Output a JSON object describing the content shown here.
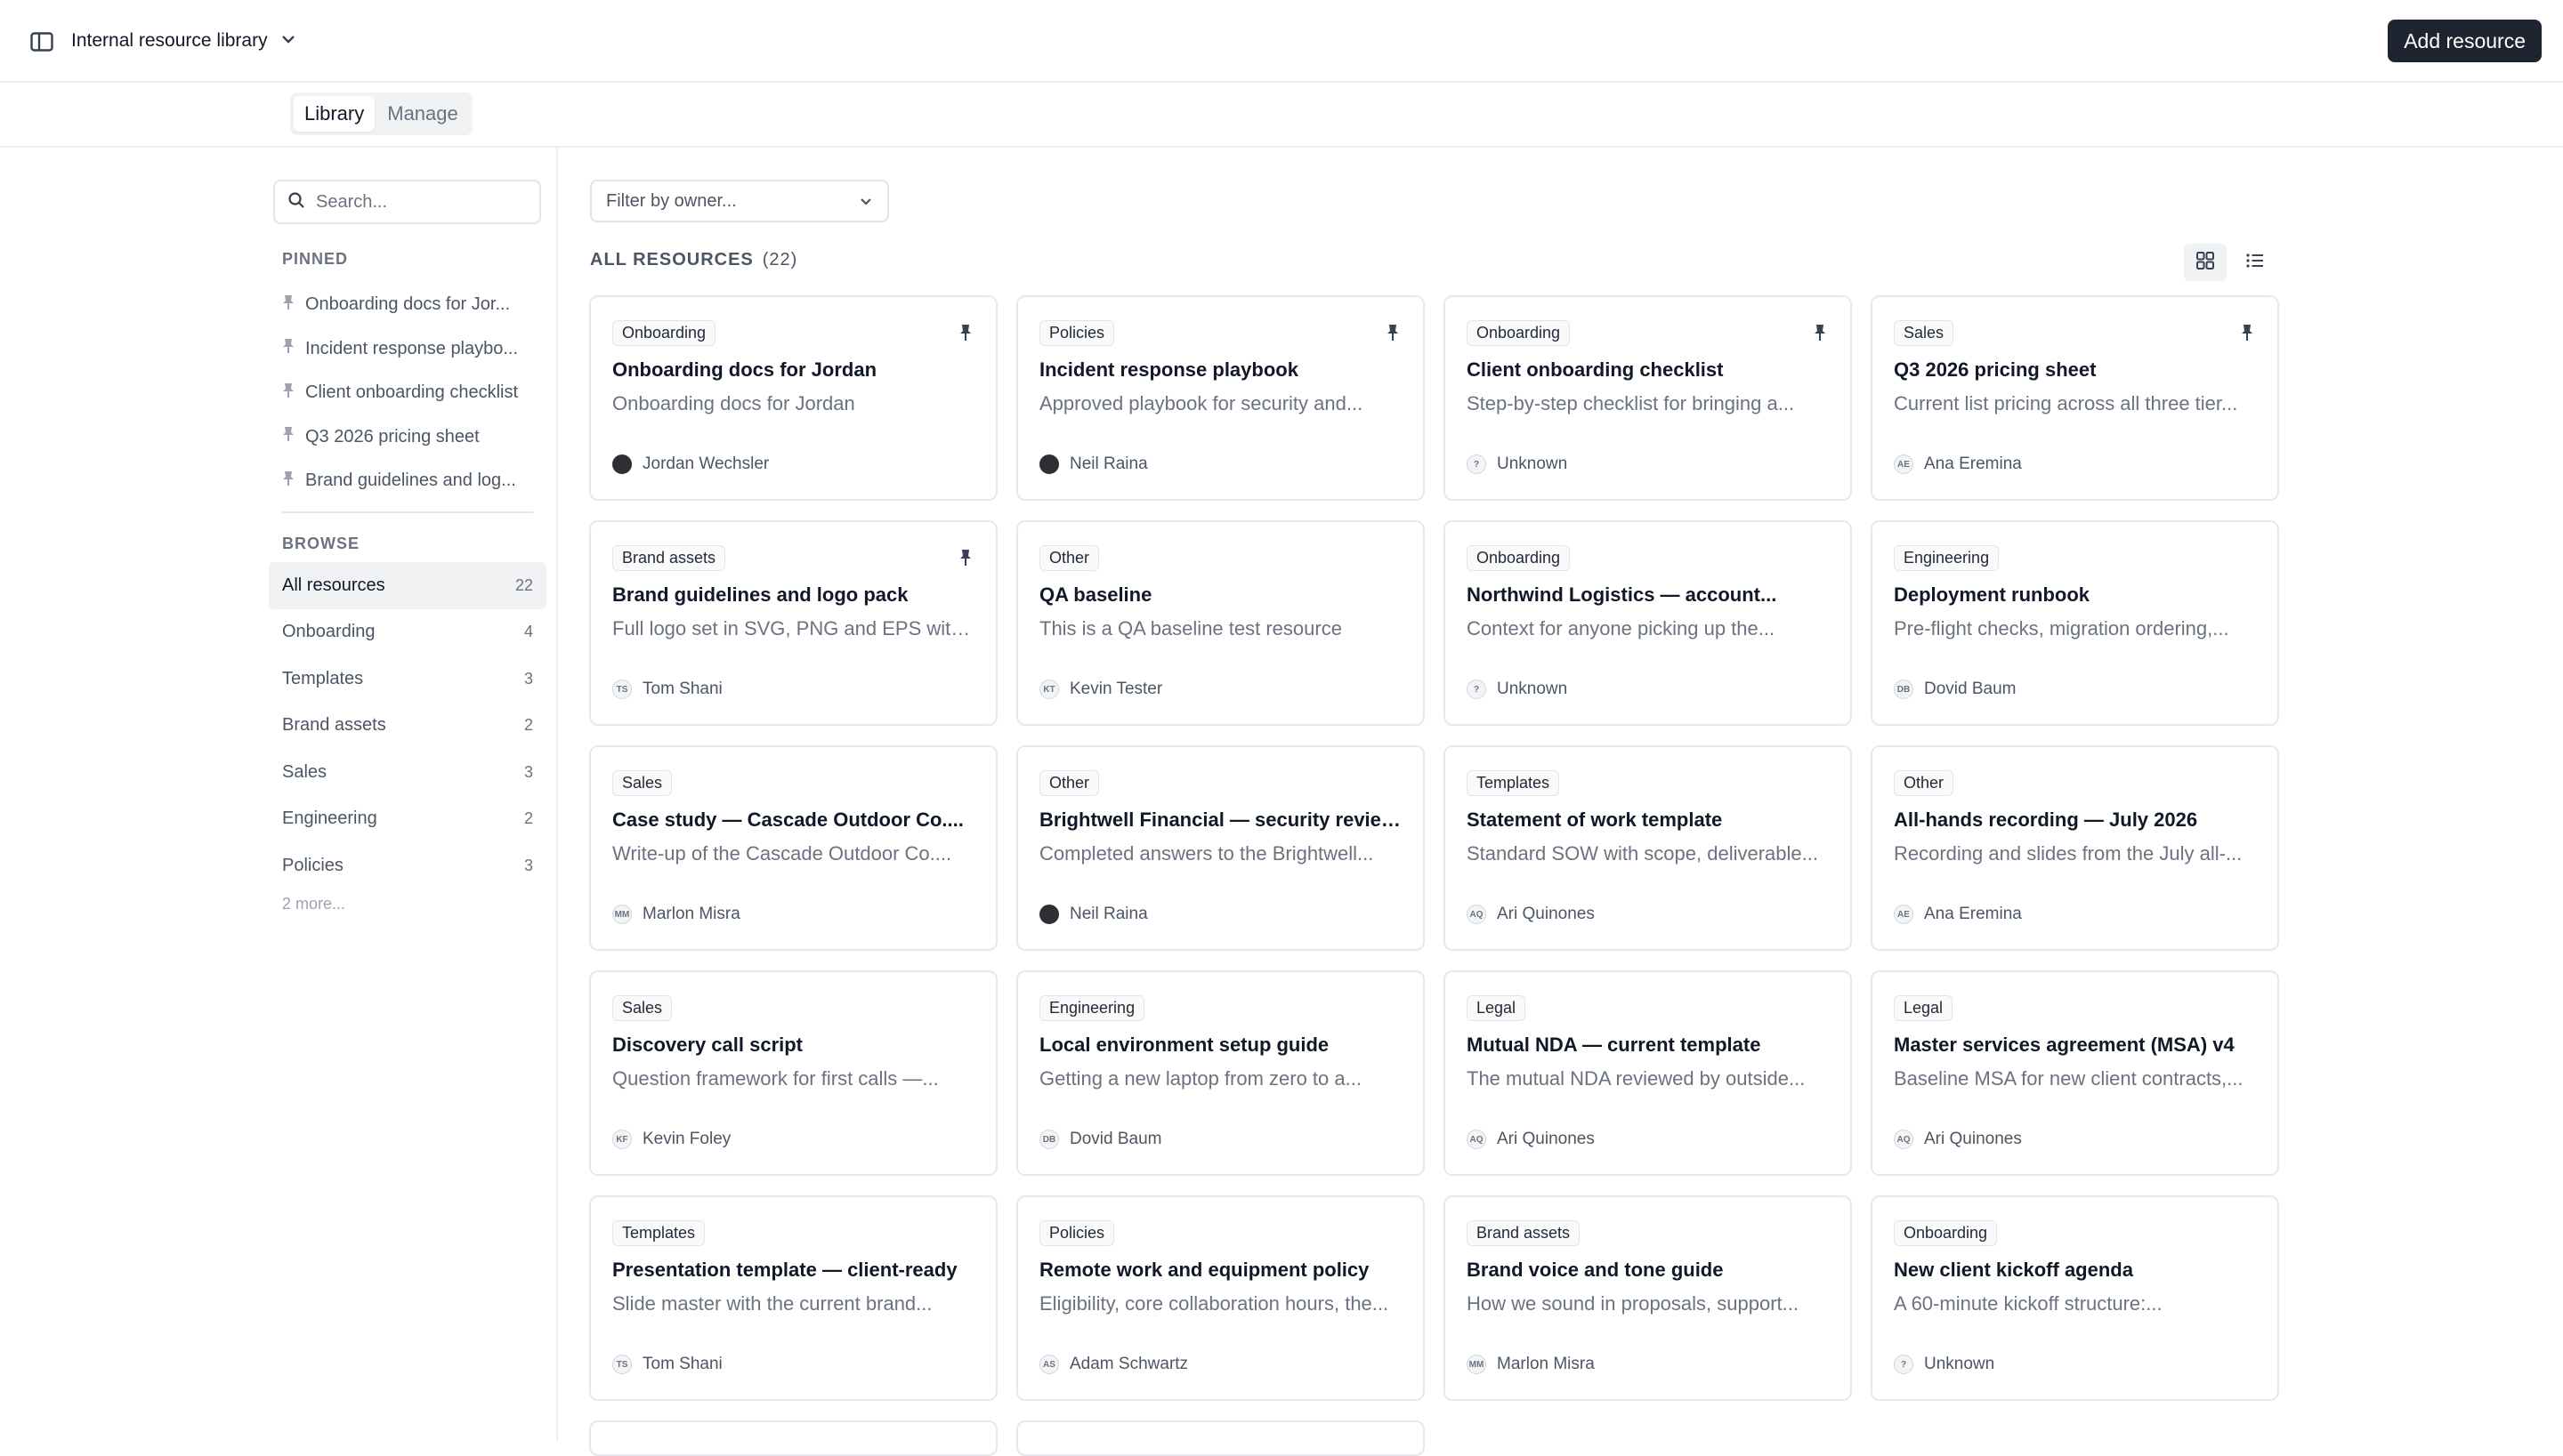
{
  "header": {
    "workspace_name": "Internal resource library",
    "add_button_label": "Add resource"
  },
  "tabs": [
    {
      "label": "Library",
      "active": true
    },
    {
      "label": "Manage",
      "active": false
    }
  ],
  "sidebar": {
    "search_placeholder": "Search...",
    "pinned_label": "PINNED",
    "pinned": [
      "Onboarding docs for Jor...",
      "Incident response playbo...",
      "Client onboarding checklist",
      "Q3 2026 pricing sheet",
      "Brand guidelines and log..."
    ],
    "browse_label": "BROWSE",
    "browse": [
      {
        "label": "All resources",
        "count": "22",
        "active": true
      },
      {
        "label": "Onboarding",
        "count": "4"
      },
      {
        "label": "Templates",
        "count": "3"
      },
      {
        "label": "Brand assets",
        "count": "2"
      },
      {
        "label": "Sales",
        "count": "3"
      },
      {
        "label": "Engineering",
        "count": "2"
      },
      {
        "label": "Policies",
        "count": "3"
      }
    ],
    "more_label": "2 more..."
  },
  "main": {
    "filter_placeholder": "Filter by owner...",
    "section_title": "ALL RESOURCES",
    "section_count": "(22)",
    "cards": [
      {
        "tag": "Onboarding",
        "title": "Onboarding docs for Jordan",
        "desc": "Onboarding docs for Jordan",
        "owner": "Jordan Wechsler",
        "initials": "",
        "photo": true,
        "pinned": true
      },
      {
        "tag": "Policies",
        "title": "Incident response playbook",
        "desc": "Approved playbook for security and...",
        "owner": "Neil Raina",
        "initials": "",
        "photo": true,
        "pinned": true
      },
      {
        "tag": "Onboarding",
        "title": "Client onboarding checklist",
        "desc": "Step-by-step checklist for bringing a...",
        "owner": "Unknown",
        "initials": "?",
        "pinned": true
      },
      {
        "tag": "Sales",
        "title": "Q3 2026 pricing sheet",
        "desc": "Current list pricing across all three tier...",
        "owner": "Ana Eremina",
        "initials": "AE",
        "pinned": true
      },
      {
        "tag": "Brand assets",
        "title": "Brand guidelines and logo pack",
        "desc": "Full logo set in SVG, PNG and EPS with...",
        "owner": "Tom Shani",
        "initials": "TS",
        "pinned": true
      },
      {
        "tag": "Other",
        "title": "QA baseline",
        "desc": "This is a QA baseline test resource",
        "owner": "Kevin Tester",
        "initials": "KT"
      },
      {
        "tag": "Onboarding",
        "title": "Northwind Logistics — account...",
        "desc": "Context for anyone picking up the...",
        "owner": "Unknown",
        "initials": "?"
      },
      {
        "tag": "Engineering",
        "title": "Deployment runbook",
        "desc": "Pre-flight checks, migration ordering,...",
        "owner": "Dovid Baum",
        "initials": "DB"
      },
      {
        "tag": "Sales",
        "title": "Case study — Cascade Outdoor Co....",
        "desc": "Write-up of the Cascade Outdoor Co....",
        "owner": "Marlon Misra",
        "initials": "MM"
      },
      {
        "tag": "Other",
        "title": "Brightwell Financial — security review...",
        "desc": "Completed answers to the Brightwell...",
        "owner": "Neil Raina",
        "initials": "",
        "photo": true
      },
      {
        "tag": "Templates",
        "title": "Statement of work template",
        "desc": "Standard SOW with scope, deliverable...",
        "owner": "Ari Quinones",
        "initials": "AQ"
      },
      {
        "tag": "Other",
        "title": "All-hands recording — July 2026",
        "desc": "Recording and slides from the July all-...",
        "owner": "Ana Eremina",
        "initials": "AE"
      },
      {
        "tag": "Sales",
        "title": "Discovery call script",
        "desc": "Question framework for first calls —...",
        "owner": "Kevin Foley",
        "initials": "KF"
      },
      {
        "tag": "Engineering",
        "title": "Local environment setup guide",
        "desc": "Getting a new laptop from zero to a...",
        "owner": "Dovid Baum",
        "initials": "DB"
      },
      {
        "tag": "Legal",
        "title": "Mutual NDA — current template",
        "desc": "The mutual NDA reviewed by outside...",
        "owner": "Ari Quinones",
        "initials": "AQ"
      },
      {
        "tag": "Legal",
        "title": "Master services agreement (MSA) v4",
        "desc": "Baseline MSA for new client contracts,...",
        "owner": "Ari Quinones",
        "initials": "AQ"
      },
      {
        "tag": "Templates",
        "title": "Presentation template — client-ready",
        "desc": "Slide master with the current brand...",
        "owner": "Tom Shani",
        "initials": "TS"
      },
      {
        "tag": "Policies",
        "title": "Remote work and equipment policy",
        "desc": "Eligibility, core collaboration hours, the...",
        "owner": "Adam Schwartz",
        "initials": "AS"
      },
      {
        "tag": "Brand assets",
        "title": "Brand voice and tone guide",
        "desc": "How we sound in proposals, support...",
        "owner": "Marlon Misra",
        "initials": "MM"
      },
      {
        "tag": "Onboarding",
        "title": "New client kickoff agenda",
        "desc": "A 60-minute kickoff structure:...",
        "owner": "Unknown",
        "initials": "?"
      }
    ]
  },
  "colors": {
    "primary_button": "#1f2530",
    "border": "#e7e8eb",
    "muted_text": "#6b7280"
  }
}
